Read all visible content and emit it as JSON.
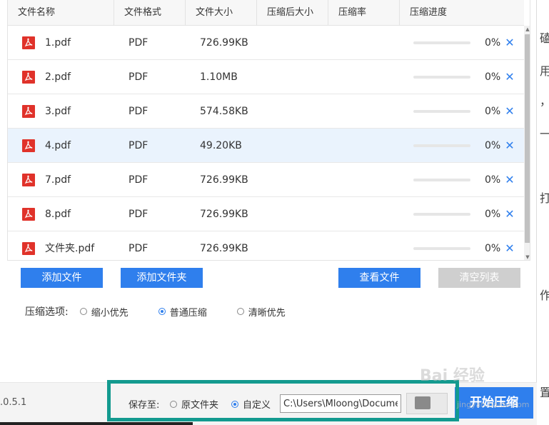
{
  "table": {
    "columns": [
      "文件名称",
      "文件格式",
      "文件大小",
      "压缩后大小",
      "压缩率",
      "压缩进度"
    ],
    "rows": [
      {
        "name": "1.pdf",
        "format": "PDF",
        "size": "726.99KB",
        "progress": 0,
        "progress_label": "0%",
        "selected": false
      },
      {
        "name": "2.pdf",
        "format": "PDF",
        "size": "1.10MB",
        "progress": 0,
        "progress_label": "0%",
        "selected": false
      },
      {
        "name": "3.pdf",
        "format": "PDF",
        "size": "574.58KB",
        "progress": 0,
        "progress_label": "0%",
        "selected": false
      },
      {
        "name": "4.pdf",
        "format": "PDF",
        "size": "49.20KB",
        "progress": 0,
        "progress_label": "0%",
        "selected": true
      },
      {
        "name": "7.pdf",
        "format": "PDF",
        "size": "726.99KB",
        "progress": 0,
        "progress_label": "0%",
        "selected": false
      },
      {
        "name": "8.pdf",
        "format": "PDF",
        "size": "726.99KB",
        "progress": 0,
        "progress_label": "0%",
        "selected": false
      },
      {
        "name": "文件夹.pdf",
        "format": "PDF",
        "size": "726.99KB",
        "progress": 0,
        "progress_label": "0%",
        "selected": false
      }
    ]
  },
  "buttons": {
    "add_file": "添加文件",
    "add_folder": "添加文件夹",
    "view_files": "查看文件",
    "clear_list": "清空列表",
    "start": "开始压缩"
  },
  "compression": {
    "label": "压缩选项:",
    "options": [
      "缩小优先",
      "普通压缩",
      "清晰优先"
    ],
    "selected": "普通压缩"
  },
  "save": {
    "label": "保存至:",
    "options": [
      "原文件夹",
      "自定义"
    ],
    "selected": "自定义",
    "path": "C:\\Users\\Mloong\\Documents"
  },
  "version": ".0.5.1",
  "watermark": {
    "main": "Bai 经验",
    "sub": "jingyan.baidu.com"
  },
  "background_doc": {
    "chars": [
      "磕",
      "用",
      "，",
      "一",
      "打",
      "作",
      "置"
    ]
  },
  "colors": {
    "accent": "#2f7fed",
    "highlight_border": "#139a8f",
    "pdf_red": "#e0322a",
    "selected_row": "#eaf3fd"
  }
}
